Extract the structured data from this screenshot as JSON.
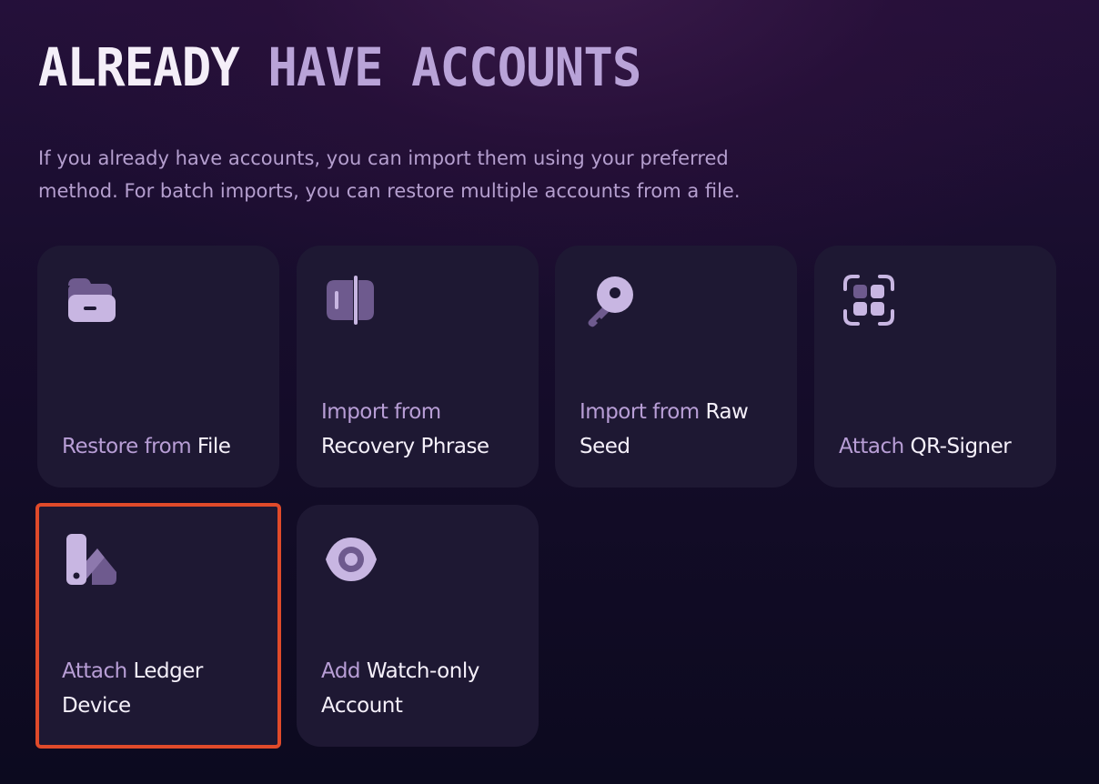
{
  "header": {
    "title_part1": "ALREADY ",
    "title_part2": "HAVE ACCOUNTS",
    "description": "If you already have accounts, you can import them using your preferred method. For batch imports, you can restore multiple accounts from a file."
  },
  "options": [
    {
      "prefix": "Restore from ",
      "highlight": "File",
      "icon": "folder-icon",
      "selected": false
    },
    {
      "prefix": "Import from ",
      "highlight": "Recovery Phrase",
      "icon": "recovery-phrase-icon",
      "selected": false
    },
    {
      "prefix": "Import from ",
      "highlight": "Raw Seed",
      "icon": "key-icon",
      "selected": false
    },
    {
      "prefix": "Attach ",
      "highlight": "QR-Signer",
      "icon": "qr-scan-icon",
      "selected": false
    },
    {
      "prefix": "Attach ",
      "highlight": "Ledger Device",
      "icon": "ledger-icon",
      "selected": true
    },
    {
      "prefix": "Add ",
      "highlight": "Watch-only Account",
      "icon": "eye-icon",
      "selected": false
    }
  ],
  "colors": {
    "accent_light": "#c8b6e2",
    "accent_muted": "#6e5a8e",
    "card_background": "#1e1833",
    "selection_outline": "#e04a2a"
  }
}
